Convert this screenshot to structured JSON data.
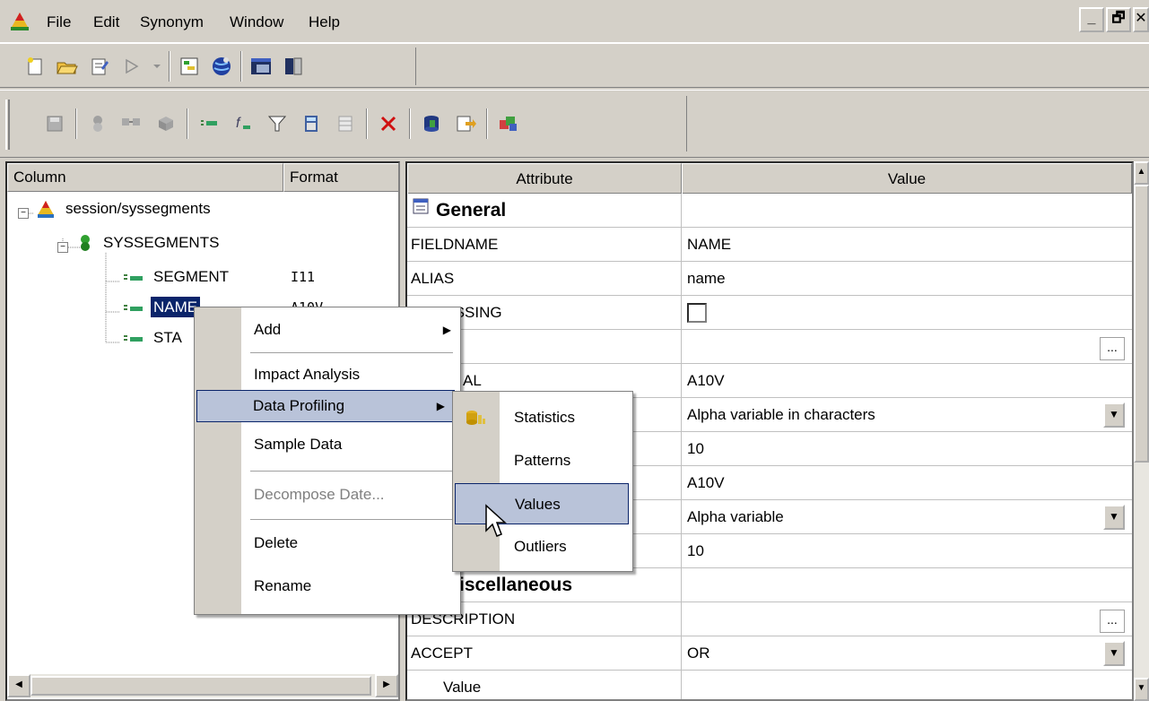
{
  "menubar": {
    "items": [
      "File",
      "Edit",
      "Synonym",
      "Window",
      "Help"
    ],
    "window_buttons": [
      "_",
      "🗗",
      "✕"
    ]
  },
  "left_panel": {
    "headers": {
      "column": "Column",
      "format": "Format"
    },
    "tree": [
      {
        "label": "session/syssegments",
        "format": ""
      },
      {
        "label": "SYSSEGMENTS",
        "format": ""
      },
      {
        "label": "SEGMENT",
        "format": "I11"
      },
      {
        "label": "NAME",
        "format": "A10V"
      },
      {
        "label": "STA",
        "format": ""
      }
    ]
  },
  "grid": {
    "headers": {
      "attribute": "Attribute",
      "value": "Value"
    },
    "rows": [
      {
        "attr": "General",
        "value": "",
        "type": "section"
      },
      {
        "attr": "FIELDNAME",
        "value": "NAME"
      },
      {
        "attr": "ALIAS",
        "value": "name"
      },
      {
        "attr": "ISSING",
        "value": "",
        "type": "checkbox"
      },
      {
        "attr": "",
        "value": "",
        "type": "ellipsis"
      },
      {
        "attr": "AL",
        "value": "A10V"
      },
      {
        "attr": "",
        "value": "Alpha variable in characters",
        "type": "dropdown"
      },
      {
        "attr": "",
        "value": "10"
      },
      {
        "attr": "",
        "value": "A10V"
      },
      {
        "attr": "",
        "value": "Alpha variable",
        "type": "dropdown"
      },
      {
        "attr": "",
        "value": "10"
      },
      {
        "attr": "iscellaneous",
        "value": "",
        "type": "section"
      },
      {
        "attr": "DESCRIPTION",
        "value": "",
        "type": "ellipsis"
      },
      {
        "attr": "ACCEPT",
        "value": "OR",
        "type": "dropdown"
      },
      {
        "attr": "Value",
        "value": ""
      }
    ]
  },
  "context_menu": {
    "items": [
      {
        "label": "Add",
        "submenu": true
      },
      {
        "label": "Impact Analysis"
      },
      {
        "label": "Data Profiling",
        "submenu": true,
        "highlighted": true
      },
      {
        "label": "Sample Data"
      },
      {
        "label": "Decompose Date...",
        "disabled": true
      },
      {
        "label": "Delete"
      },
      {
        "label": "Rename"
      }
    ]
  },
  "submenu": {
    "items": [
      {
        "label": "Statistics"
      },
      {
        "label": "Patterns"
      },
      {
        "label": "Values",
        "highlighted": true
      },
      {
        "label": "Outliers"
      }
    ]
  }
}
